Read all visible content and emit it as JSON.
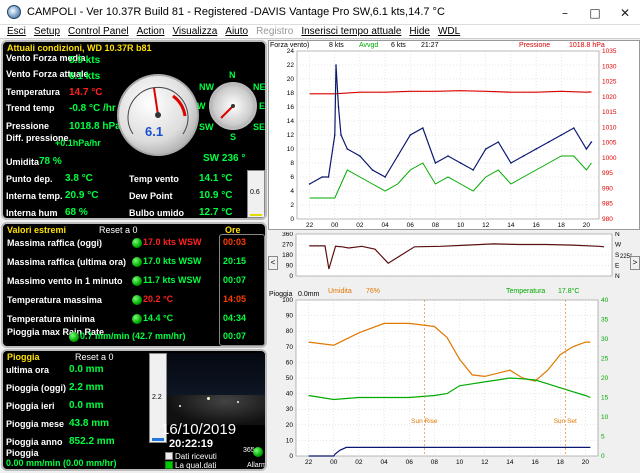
{
  "window": {
    "title": "CAMPOLI - Ver 10.37R Build 81 - Registered  -DAVIS Vantage Pro  SW,6.1 kts,14.7 °C"
  },
  "menu": [
    {
      "label": "Esci",
      "disabled": false
    },
    {
      "label": "Setup",
      "disabled": false
    },
    {
      "label": "Control Panel",
      "disabled": false
    },
    {
      "label": "Action",
      "disabled": false
    },
    {
      "label": "Visualizza",
      "disabled": false
    },
    {
      "label": "Aiuto",
      "disabled": false
    },
    {
      "label": "Registro",
      "disabled": true
    },
    {
      "label": "Inserisci tempo attuale",
      "disabled": false
    },
    {
      "label": "Hide",
      "disabled": false
    },
    {
      "label": "WDL",
      "disabled": false
    }
  ],
  "current": {
    "header": "Attuali condizioni, WD 10.37R b81",
    "wind_avg_label": "Vento Forza media",
    "wind_avg": "5.9 kts",
    "wind_now_label": "Vento Forza attuale",
    "wind_now": "6.1 kts",
    "temp_label": "Temperatura",
    "temp": "14.7 °C",
    "trend_label": "Trend temp",
    "trend": "-0.8 °C /hr",
    "pressure_label": "Pressione",
    "pressure": "1018.8 hPa",
    "pdiff_label": "Diff. pressione",
    "pdiff": "+0.1hPa/hr",
    "hum_label": "Umidita",
    "hum": "78 %",
    "dew_label": "Punto dep.",
    "dew": "3.8 °C",
    "int_temp_label": "Interna temp.",
    "int_temp": "20.9 °C",
    "int_hum_label": "Interna hum",
    "int_hum": "68 %",
    "windchill_label": "Temp vento",
    "windchill": "14.1 °C",
    "dewpoint_label": "Dew Point",
    "dewpoint": "10.9 °C",
    "wetbulb_label": "Bulbo umido",
    "wetbulb": "12.7 °C",
    "dir": "SW 236 °",
    "gauge_speed": "6.1",
    "gauge_small_label": "0.6",
    "compass": {
      "n": "N",
      "ne": "NE",
      "nw": "NW",
      "w": "W",
      "e": "E",
      "sw": "SW",
      "s": "S",
      "se": "SE"
    }
  },
  "extremes": {
    "header": "Valori estremi",
    "reset": "Reset a 0",
    "time_header": "Ore",
    "rows": [
      {
        "label": "Massima raffica (oggi)",
        "value": "17.0 kts WSW",
        "time": "00:03"
      },
      {
        "label": "Massima raffica (ultima ora)",
        "value": "17.0 kts WSW",
        "time": "20:15"
      },
      {
        "label": "Massimo vento in 1 minuto",
        "value": "11.7 kts WSW",
        "time": "00:07"
      },
      {
        "label": "Temperatura massima",
        "value": "20.2 °C",
        "time": "14:05"
      },
      {
        "label": "Temperatura minima",
        "value": "14.4 °C",
        "time": "04:34"
      },
      {
        "label": "Pioggia max Rain Rate",
        "value": "0.7 mm/min (42.7 mm/hr)",
        "time": "00:07"
      }
    ]
  },
  "rain": {
    "header": "Pioggia",
    "reset": "Reset a 0",
    "rows": [
      {
        "label": "ultima ora",
        "value": "0.0 mm"
      },
      {
        "label": "Pioggia (oggi)",
        "value": "2.2 mm"
      },
      {
        "label": "Pioggia ieri",
        "value": "0.0 mm"
      },
      {
        "label": "Pioggia mese",
        "value": "43.8 mm"
      },
      {
        "label": "Pioggia anno",
        "value": "852.2 mm"
      }
    ],
    "rate_label": "Pioggia",
    "rate": "0.00 mm/min (0.00 mm/hr)",
    "gauge_small": "2.2"
  },
  "cam": {
    "date": "16/10/2019",
    "time": "20:22:19",
    "received": "Dati ricevuti",
    "quality": "La qual.dati",
    "alarm": "Allarm",
    "counter": "365"
  },
  "chart_data": [
    {
      "type": "line",
      "title": "",
      "legend": [
        "Forza vento)",
        "8 kts",
        "Avvgd",
        "6 kts",
        "21:27",
        "Pressione",
        "1018.8 hPa"
      ],
      "xticks": [
        "22",
        "00",
        "02",
        "04",
        "06",
        "08",
        "10",
        "12",
        "14",
        "16",
        "18",
        "20"
      ],
      "yleft": [
        "0",
        "2",
        "4",
        "6",
        "8",
        "10",
        "12",
        "14",
        "16",
        "18",
        "20",
        "22",
        "24"
      ],
      "yright": [
        "980",
        "985",
        "990",
        "995",
        "1000",
        "1005",
        "1010",
        "1015",
        "1020",
        "1025",
        "1030",
        "1035"
      ],
      "series": [
        {
          "name": "Forza vento)",
          "x": [
            -2,
            -1,
            -0.5,
            0,
            0.1,
            0.3,
            0.5,
            1,
            2,
            3,
            4,
            5,
            6,
            7,
            8,
            9,
            10,
            11,
            12,
            13,
            14,
            15,
            16,
            17,
            18,
            19,
            20,
            20.4
          ],
          "values": [
            5,
            6,
            6,
            12,
            22,
            16,
            12,
            10,
            9,
            7,
            6,
            9,
            12,
            13,
            8,
            9,
            8,
            7,
            10,
            11,
            8,
            9,
            10,
            11,
            12,
            13,
            10,
            11
          ]
        },
        {
          "name": "Avvgd",
          "x": [
            -2,
            -1,
            0,
            1,
            2,
            3,
            4,
            5,
            6,
            7,
            8,
            9,
            10,
            11,
            12,
            13,
            14,
            15,
            16,
            17,
            18,
            19,
            20,
            20.4
          ],
          "values": [
            3,
            3,
            3,
            7,
            6,
            5,
            4,
            5,
            7,
            8,
            5,
            6,
            5,
            4,
            6,
            7,
            5,
            6,
            7,
            8,
            9,
            9,
            7,
            8
          ]
        },
        {
          "name": "Pressione",
          "x": [
            -2,
            0,
            2,
            4,
            6,
            8,
            10,
            12,
            14,
            16,
            18,
            20,
            20.4
          ],
          "values": [
            1021,
            1021,
            1021.5,
            1021.5,
            1021.8,
            1021.8,
            1022,
            1021.8,
            1021.5,
            1021.5,
            1021.8,
            1021.5,
            1021.6
          ]
        }
      ]
    },
    {
      "type": "line",
      "title": "",
      "legend": [],
      "xticks": [],
      "yleft": [
        "0",
        "90",
        "180",
        "270",
        "360"
      ],
      "yright": [
        "N",
        "E",
        "S",
        "W",
        "N"
      ],
      "right_value": "225°",
      "series": [
        {
          "name": "",
          "x": [
            -2,
            -0.8,
            -0.5,
            0,
            0.5,
            1,
            2,
            3,
            4,
            6,
            8,
            10,
            12,
            14,
            16,
            18,
            20,
            20.4
          ],
          "values": [
            258,
            258,
            60,
            255,
            250,
            240,
            255,
            230,
            110,
            250,
            255,
            265,
            275,
            270,
            270,
            265,
            255,
            250
          ]
        }
      ]
    },
    {
      "type": "line",
      "title": "",
      "legend": [
        "Pioggia",
        "0.0mm",
        "Umidita",
        "76%",
        "Temperatura",
        "17.8°C"
      ],
      "xticks": [
        "22",
        "00",
        "02",
        "04",
        "06",
        "08",
        "10",
        "12",
        "14",
        "16",
        "18",
        "20"
      ],
      "yleft": [
        "0",
        "10",
        "20",
        "30",
        "40",
        "50",
        "60",
        "70",
        "80",
        "90",
        "100"
      ],
      "yright": [
        "0",
        "5",
        "10",
        "15",
        "20",
        "25",
        "30",
        "35",
        "40"
      ],
      "annotations": [
        "Sun Rise",
        "Sun Set"
      ],
      "series": [
        {
          "name": "Umidita",
          "x": [
            -2,
            0,
            2,
            4,
            6,
            8,
            9,
            10,
            11,
            12,
            13,
            14,
            15,
            16,
            17,
            18,
            19,
            20,
            20.4
          ],
          "values": [
            73,
            71,
            79,
            85,
            85,
            83,
            76,
            62,
            52,
            51,
            53,
            55,
            50,
            48,
            55,
            65,
            70,
            73,
            73
          ]
        },
        {
          "name": "Temperatura",
          "x": [
            -2,
            0,
            2,
            4,
            6,
            8,
            9,
            10,
            11,
            12,
            13,
            14,
            15,
            16,
            17,
            18,
            19,
            20,
            20.4
          ],
          "values": [
            15.5,
            14.5,
            15,
            15,
            15,
            15.5,
            16,
            18,
            18.5,
            19,
            19.5,
            20,
            19.8,
            19.5,
            18.5,
            17.5,
            16.5,
            15.5,
            15
          ]
        },
        {
          "name": "Pioggia",
          "x": [
            -2,
            0,
            0.1,
            0.5,
            1,
            20.4
          ],
          "values": [
            0,
            0,
            0.5,
            1.5,
            2.2,
            2.2
          ]
        }
      ]
    }
  ]
}
